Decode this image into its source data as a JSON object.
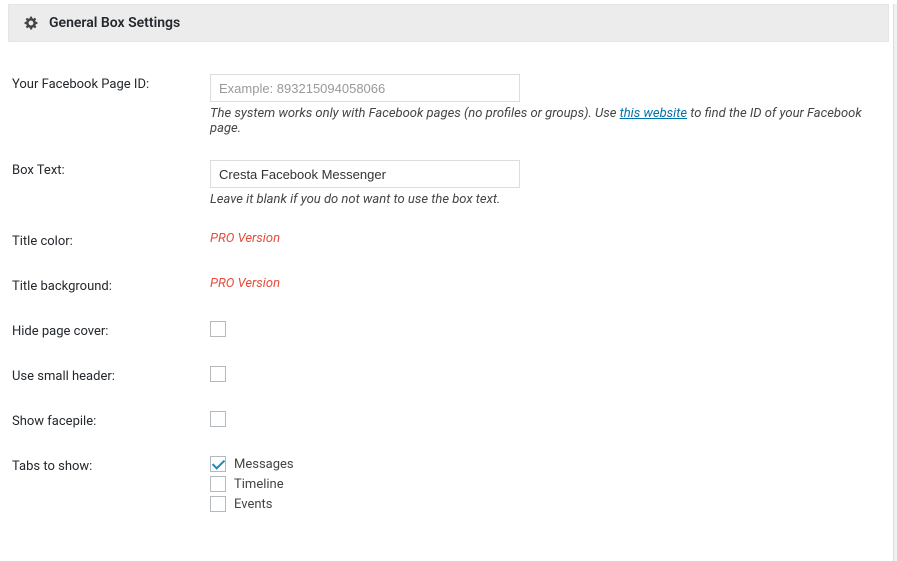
{
  "header": {
    "title": "General Box Settings"
  },
  "fields": {
    "facebook_page_id": {
      "label": "Your Facebook Page ID:",
      "placeholder": "Example: 893215094058066",
      "value": "",
      "description_pre": "The system works only with Facebook pages (no profiles or groups). Use ",
      "description_link": "this website",
      "description_post": " to find the ID of your Facebook page."
    },
    "box_text": {
      "label": "Box Text:",
      "value": "Cresta Facebook Messenger",
      "description": "Leave it blank if you do not want to use the box text."
    },
    "title_color": {
      "label": "Title color:",
      "pro_text": "PRO Version"
    },
    "title_background": {
      "label": "Title background:",
      "pro_text": "PRO Version"
    },
    "hide_page_cover": {
      "label": "Hide page cover:",
      "checked": false
    },
    "use_small_header": {
      "label": "Use small header:",
      "checked": false
    },
    "show_facepile": {
      "label": "Show facepile:",
      "checked": false
    },
    "tabs_to_show": {
      "label": "Tabs to show:",
      "options": [
        {
          "label": "Messages",
          "checked": true
        },
        {
          "label": "Timeline",
          "checked": false
        },
        {
          "label": "Events",
          "checked": false
        }
      ]
    }
  }
}
